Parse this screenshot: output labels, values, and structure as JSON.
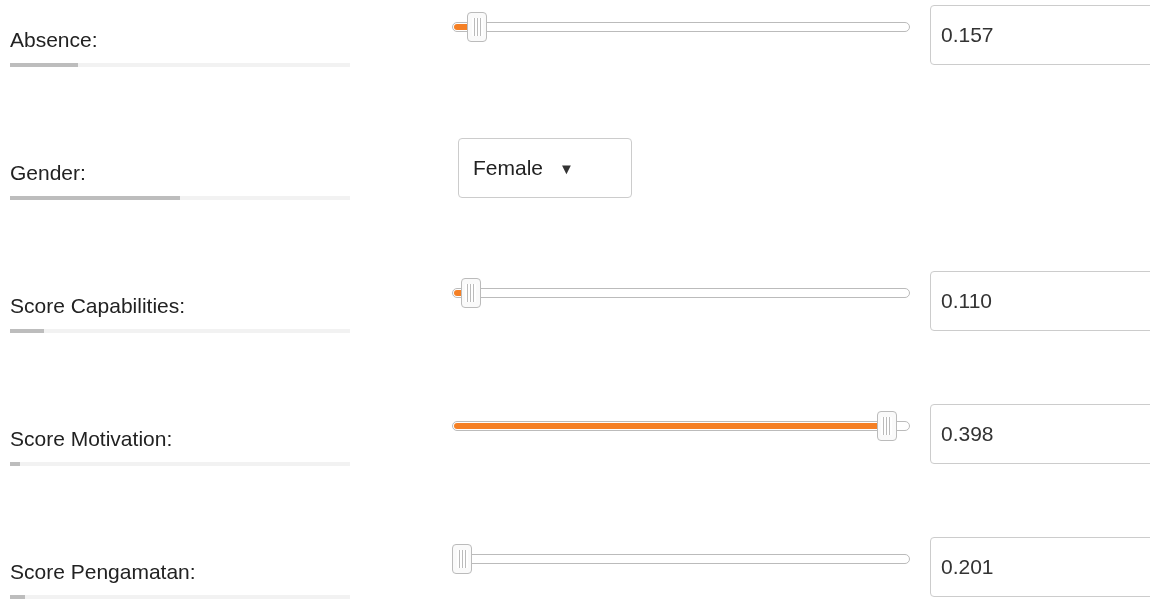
{
  "fields": [
    {
      "kind": "slider",
      "label": "Absence:",
      "importance": {
        "level": 0.2
      },
      "slider": {
        "level": 0.035
      },
      "value": "0.157"
    },
    {
      "kind": "dropdown",
      "label": "Gender:",
      "importance": {
        "level": 0.5
      },
      "selected_option": "Female",
      "caret": "▼"
    },
    {
      "kind": "slider",
      "label": "Score Capabilities:",
      "importance": {
        "level": 0.1
      },
      "slider": {
        "level": 0.02
      },
      "value": "0.110"
    },
    {
      "kind": "slider",
      "label": "Score Motivation:",
      "importance": {
        "level": 0.03
      },
      "slider": {
        "level": 0.97
      },
      "value": "0.398"
    },
    {
      "kind": "slider",
      "label": "Score Pengamatan:",
      "importance": {
        "level": 0.045
      },
      "slider": {
        "level": 0.0
      },
      "value": "0.201"
    }
  ]
}
